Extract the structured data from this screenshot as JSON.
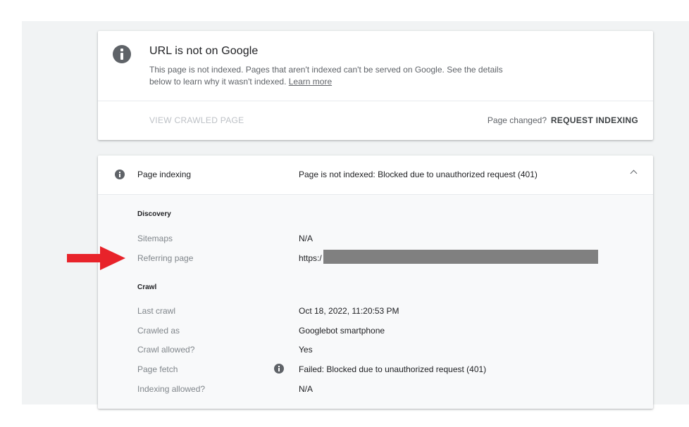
{
  "status": {
    "title": "URL is not on Google",
    "description": "This page is not indexed. Pages that aren't indexed can't be served on Google. See the details below to learn why it wasn't indexed.",
    "learn_more": "Learn more",
    "view_crawled": "VIEW CRAWLED PAGE",
    "page_changed": "Page changed?",
    "request_indexing": "REQUEST INDEXING"
  },
  "indexing": {
    "label": "Page indexing",
    "value": "Page is not indexed: Blocked due to unauthorized request (401)",
    "discovery": {
      "title": "Discovery",
      "sitemaps_label": "Sitemaps",
      "sitemaps_value": "N/A",
      "referring_label": "Referring page",
      "referring_value": "https:/"
    },
    "crawl": {
      "title": "Crawl",
      "last_crawl_label": "Last crawl",
      "last_crawl_value": "Oct 18, 2022, 11:20:53 PM",
      "crawled_as_label": "Crawled as",
      "crawled_as_value": "Googlebot smartphone",
      "crawl_allowed_label": "Crawl allowed?",
      "crawl_allowed_value": "Yes",
      "page_fetch_label": "Page fetch",
      "page_fetch_value": "Failed: Blocked due to unauthorized request (401)",
      "indexing_allowed_label": "Indexing allowed?",
      "indexing_allowed_value": "N/A"
    }
  },
  "colors": {
    "arrow": "#e8232a",
    "redaction": "#808080"
  }
}
